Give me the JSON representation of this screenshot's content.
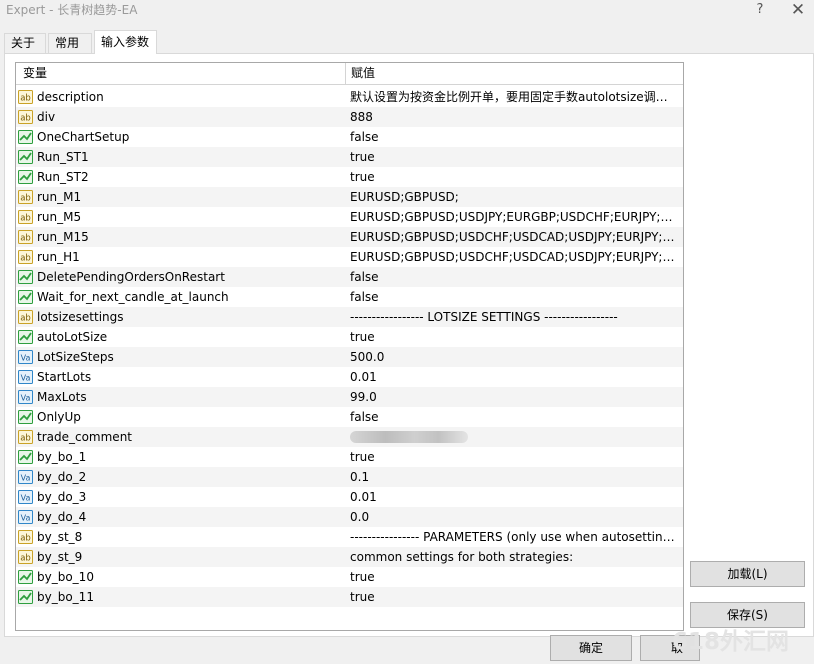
{
  "window": {
    "title": "Expert - 长青树趋势-EA",
    "help_glyph": "?",
    "close_glyph": "✕"
  },
  "tabs": [
    {
      "label": "关于",
      "active": false
    },
    {
      "label": "常用",
      "active": false
    },
    {
      "label": "输入参数",
      "active": true
    }
  ],
  "grid": {
    "columns": {
      "variable": "变量",
      "value": "赋值"
    },
    "rows": [
      {
        "type": "string",
        "name": "description",
        "value": "默认设置为按资金比例开单，要用固定手数autolotsize调为false"
      },
      {
        "type": "string",
        "name": "div",
        "value": "888"
      },
      {
        "type": "bool",
        "name": "OneChartSetup",
        "value": "false"
      },
      {
        "type": "bool",
        "name": "Run_ST1",
        "value": "true"
      },
      {
        "type": "bool",
        "name": "Run_ST2",
        "value": "true"
      },
      {
        "type": "string",
        "name": "run_M1",
        "value": "EURUSD;GBPUSD;"
      },
      {
        "type": "string",
        "name": "run_M5",
        "value": "EURUSD;GBPUSD;USDJPY;EURGBP;USDCHF;EURJPY;GBPJ..."
      },
      {
        "type": "string",
        "name": "run_M15",
        "value": "EURUSD;GBPUSD;USDCHF;USDCAD;USDJPY;EURJPY;GBPJ..."
      },
      {
        "type": "string",
        "name": "run_H1",
        "value": "EURUSD;GBPUSD;USDCHF;USDCAD;USDJPY;EURJPY;GBPJ..."
      },
      {
        "type": "bool",
        "name": "DeletePendingOrdersOnRestart",
        "value": "false"
      },
      {
        "type": "bool",
        "name": "Wait_for_next_candle_at_launch",
        "value": "false"
      },
      {
        "type": "string",
        "name": "lotsizesettings",
        "value": "----------------- LOTSIZE SETTINGS -----------------"
      },
      {
        "type": "bool",
        "name": "autoLotSize",
        "value": "true"
      },
      {
        "type": "number",
        "name": "LotSizeSteps",
        "value": "500.0"
      },
      {
        "type": "number",
        "name": "StartLots",
        "value": "0.01"
      },
      {
        "type": "number",
        "name": "MaxLots",
        "value": "99.0"
      },
      {
        "type": "bool",
        "name": "OnlyUp",
        "value": "false"
      },
      {
        "type": "string",
        "name": "trade_comment",
        "value": "",
        "redacted": true
      },
      {
        "type": "bool",
        "name": "by_bo_1",
        "value": "true"
      },
      {
        "type": "number",
        "name": "by_do_2",
        "value": "0.1"
      },
      {
        "type": "number",
        "name": "by_do_3",
        "value": "0.01"
      },
      {
        "type": "number",
        "name": "by_do_4",
        "value": "0.0"
      },
      {
        "type": "string",
        "name": "by_st_8",
        "value": "---------------- PARAMETERS (only use when autosettings..."
      },
      {
        "type": "string",
        "name": "by_st_9",
        "value": "common settings for both strategies:"
      },
      {
        "type": "bool",
        "name": "by_bo_10",
        "value": "true"
      },
      {
        "type": "bool",
        "name": "by_bo_11",
        "value": "true"
      }
    ]
  },
  "buttons": {
    "load": "加载(L)",
    "save": "保存(S)",
    "ok": "确定",
    "cancel": "取"
  },
  "watermark": "618外汇网",
  "colors": {
    "string_icon": "#c9a227",
    "bool_icon": "#2e9e3e",
    "number_icon": "#2f86c8"
  }
}
